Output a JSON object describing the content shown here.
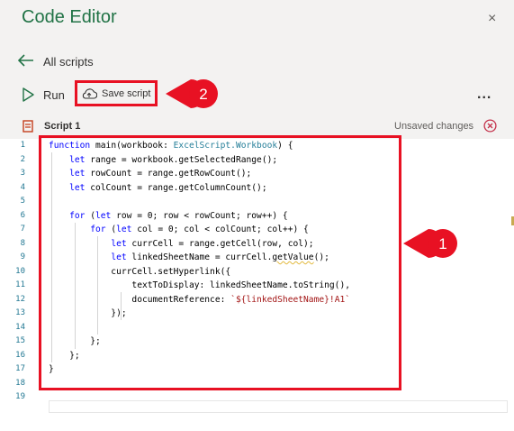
{
  "header": {
    "title": "Code Editor",
    "close_glyph": "×"
  },
  "nav": {
    "back_label": "All scripts"
  },
  "toolbar": {
    "run_label": "Run",
    "save_label": "Save script",
    "more_glyph": "..."
  },
  "script": {
    "name": "Script 1",
    "status": "Unsaved changes"
  },
  "callouts": [
    {
      "number": "1"
    },
    {
      "number": "2"
    }
  ],
  "editor": {
    "line_numbers": [
      "1",
      "2",
      "3",
      "4",
      "5",
      "6",
      "7",
      "8",
      "9",
      "10",
      "11",
      "12",
      "13",
      "14",
      "15",
      "16",
      "17",
      "18",
      "19"
    ],
    "lines": [
      "function main(workbook: ExcelScript.Workbook) {",
      "    let range = workbook.getSelectedRange();",
      "    let rowCount = range.getRowCount();",
      "    let colCount = range.getColumnCount();",
      "",
      "    for (let row = 0; row < rowCount; row++) {",
      "        for (let col = 0; col < colCount; col++) {",
      "            let currCell = range.getCell(row, col);",
      "            let linkedSheetName = currCell.getValue();",
      "            currCell.setHyperlink({",
      "                textToDisplay: linkedSheetName.toString(),",
      "                documentReference: `${linkedSheetName}!A1`",
      "            });",
      "",
      "        };",
      "    };",
      "}",
      "",
      ""
    ]
  },
  "colors": {
    "accent": "#217346",
    "annotation_red": "#e81123",
    "keyword": "#0000ff",
    "string": "#a31515",
    "type": "#267f99"
  },
  "icons": [
    "back-arrow-icon",
    "play-icon",
    "cloud-save-icon",
    "more-icon",
    "close-icon",
    "script-file-icon",
    "close-circle-icon"
  ]
}
